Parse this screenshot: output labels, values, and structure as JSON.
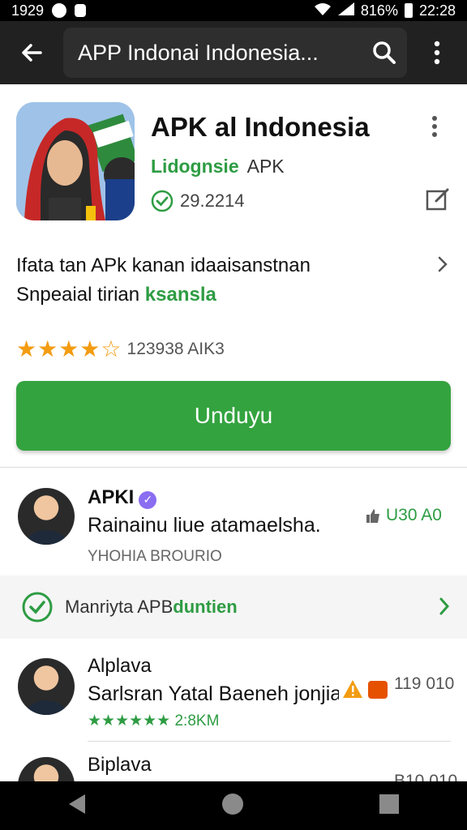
{
  "status": {
    "time_left": "1929",
    "battery": "816%",
    "time_right": "22:28"
  },
  "appbar": {
    "search_text": "APP Indonai Indonesia..."
  },
  "app": {
    "title": "APK al Indonesia",
    "developer_highlight": "Lidognsie",
    "developer_suffix": "APK",
    "meta": "29.2214",
    "rating_text": "123938 AIK3",
    "download_label": "Unduyu"
  },
  "description": {
    "line1": "Ifata tan APk kanan idaaisanstnan",
    "line2_prefix": "Snpeaial tirian",
    "line2_highlight": "ksansla"
  },
  "reviews": [
    {
      "name": "APKI",
      "text": "Rainainu liue atamaelsha.",
      "sub": "YHOHIA BROURIO",
      "count": "U30 A0",
      "count_color": "#2e9c43"
    },
    {
      "name": "Alplava",
      "text": "Sarlsran Yatal Baeneh jonjia..",
      "sub": "★★★★★★  2:8KM",
      "count": "119 010",
      "count_color": "#555555"
    },
    {
      "name": "Biplava",
      "text": "",
      "sub": "",
      "count": "B10 010",
      "count_color": "#555555"
    }
  ],
  "promo": {
    "prefix": "Manriyta APB",
    "highlight": "duntien"
  },
  "colors": {
    "accent": "#2e9c43",
    "button": "#33a33f"
  },
  "icons": [
    "back-arrow-icon",
    "search-icon",
    "more-vert-icon",
    "check-circle-icon",
    "edit-icon",
    "chevron-right-icon",
    "verified-badge-icon",
    "warning-icon",
    "nav-back-icon",
    "nav-home-icon",
    "nav-recents-icon"
  ]
}
